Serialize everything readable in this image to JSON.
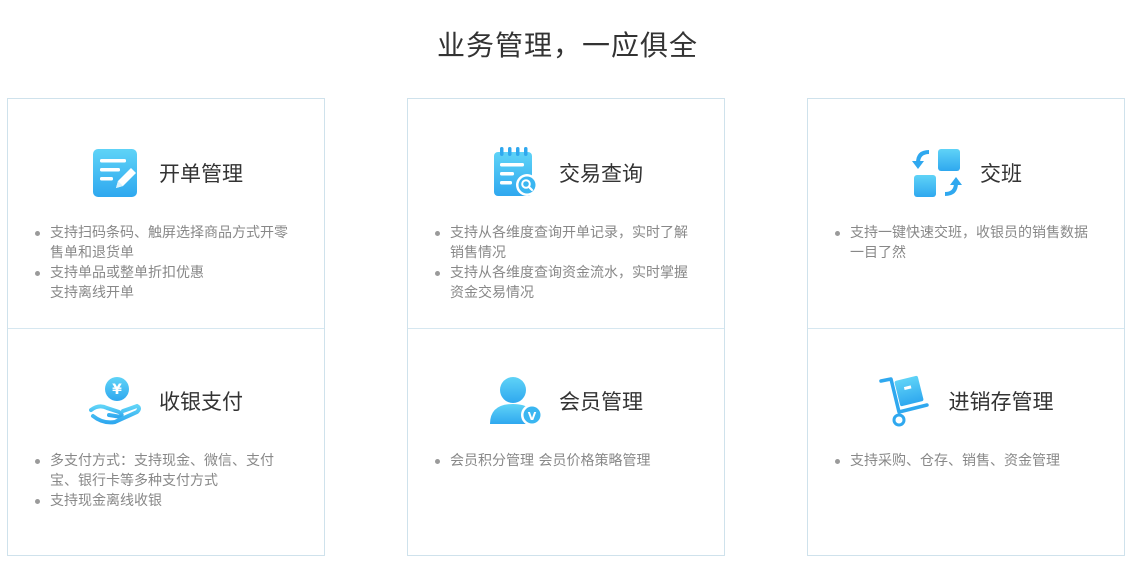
{
  "page": {
    "title": "业务管理，一应俱全"
  },
  "colors": {
    "accent": "#2fb3f0",
    "accent_light": "#5fd3f7",
    "border": "#cfe2ec",
    "title_text": "#333333",
    "body_text": "#888888"
  },
  "columns": [
    {
      "top": {
        "icon": "edit-document-icon",
        "title": "开单管理",
        "items": [
          "支持扫码条码、触屏选择商品方式开零售单和退货单",
          "支持单品或整单折扣优惠",
          "支持离线开单"
        ]
      },
      "bottom": {
        "icon": "yuan-payment-hand-icon",
        "title": "收银支付",
        "items": [
          "多支付方式：支持现金、微信、支付宝、银行卡等多种支付方式",
          "支持现金离线收银"
        ]
      }
    },
    {
      "top": {
        "icon": "search-record-icon",
        "title": "交易查询",
        "items": [
          "支持从各维度查询开单记录，实时了解销售情况",
          "支持从各维度查询资金流水，实时掌握资金交易情况"
        ]
      },
      "bottom": {
        "icon": "member-icon",
        "title": "会员管理",
        "items": [
          "会员积分管理 会员价格策略管理"
        ]
      }
    },
    {
      "top": {
        "icon": "shift-exchange-icon",
        "title": "交班",
        "items": [
          "支持一键快速交班，收银员的销售数据一目了然"
        ]
      },
      "bottom": {
        "icon": "inventory-cart-icon",
        "title": "进销存管理",
        "items": [
          "支持采购、仓存、销售、资金管理"
        ]
      }
    }
  ]
}
